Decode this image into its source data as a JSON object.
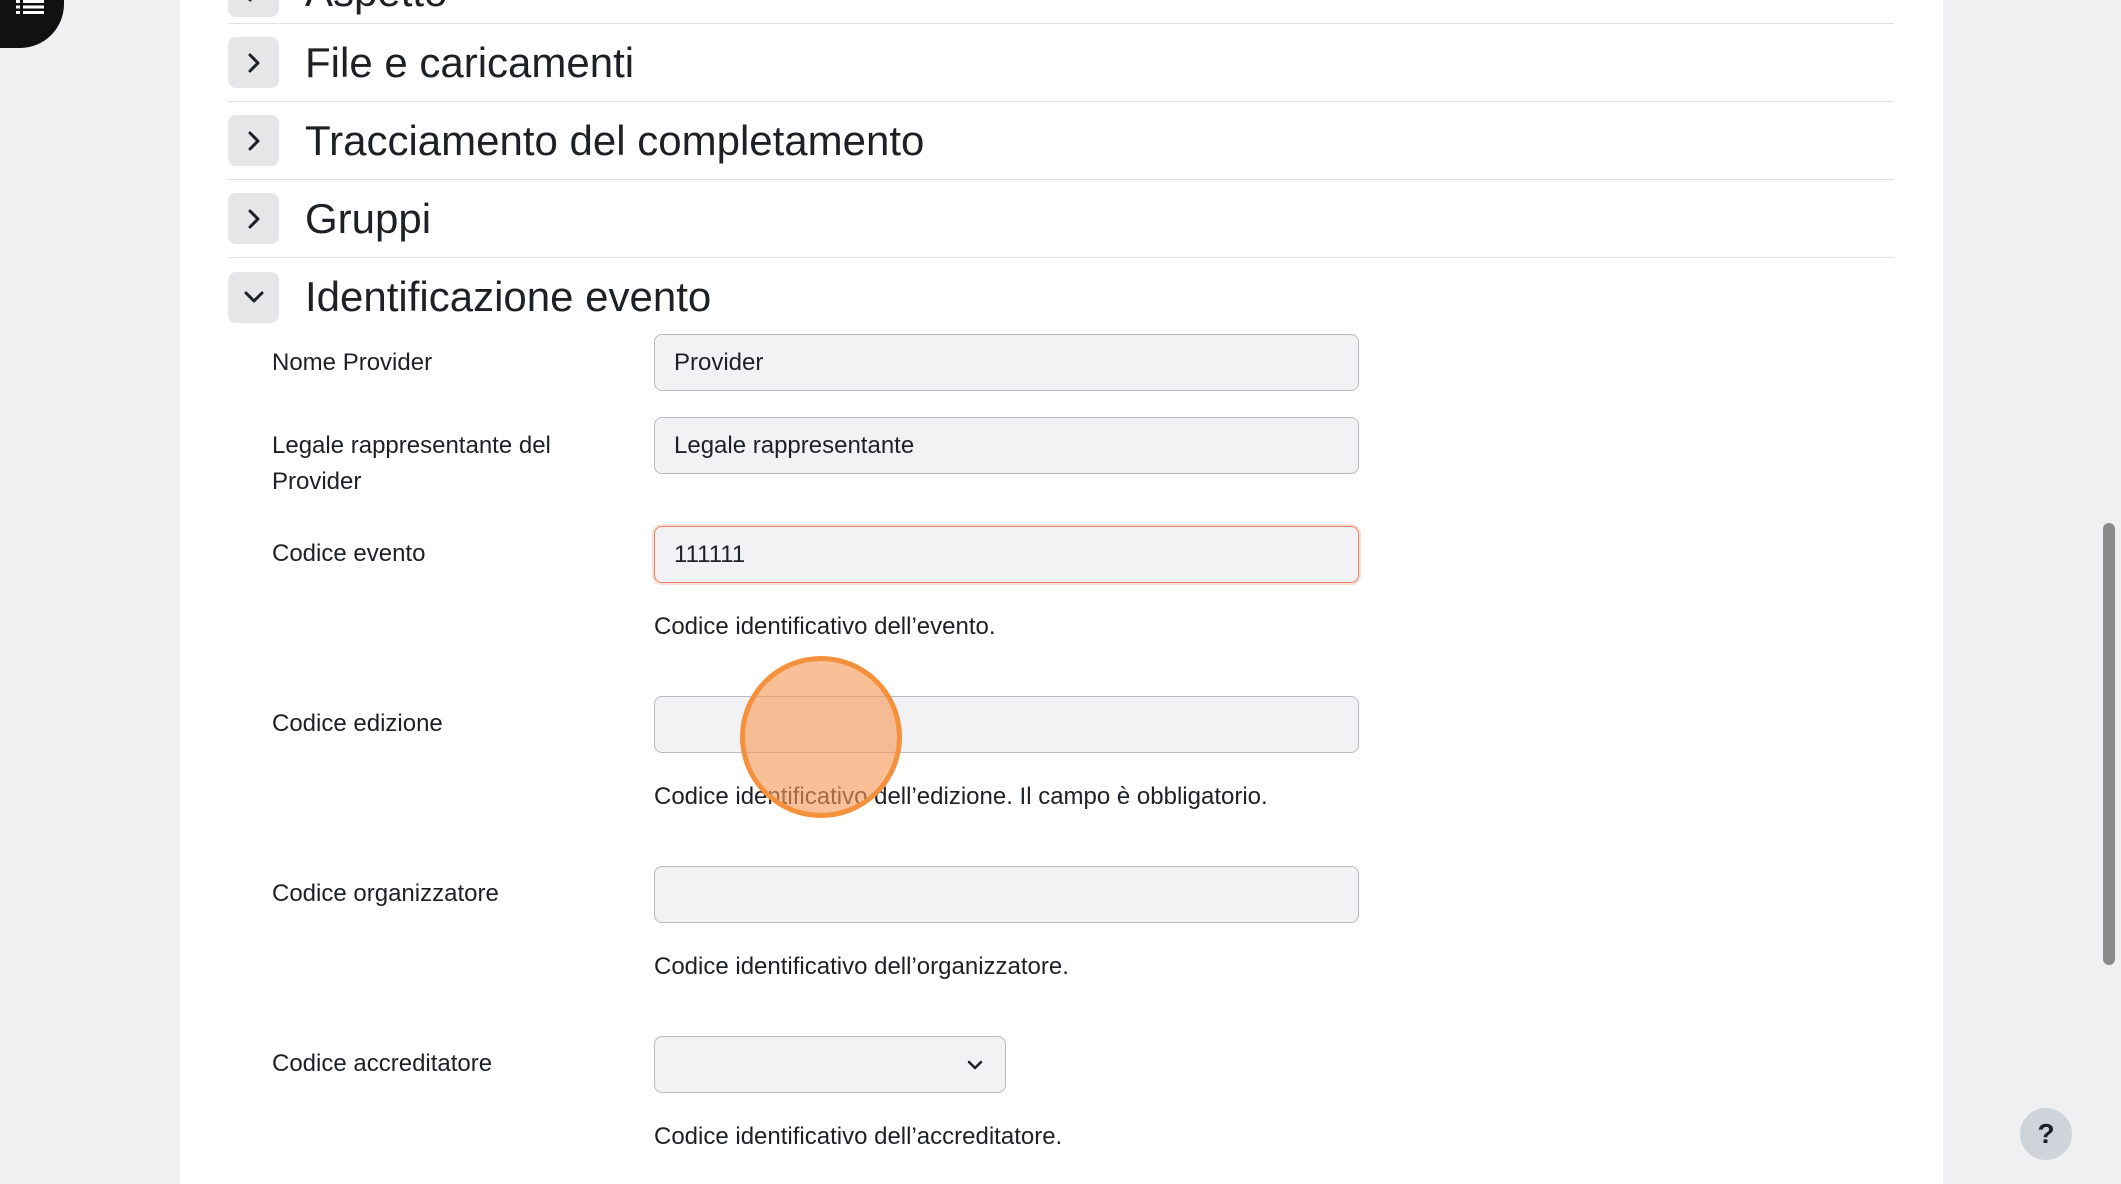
{
  "nav": {
    "drawer_icon": "list-icon"
  },
  "sections": {
    "partial_title": "Aspetto",
    "files": {
      "title": "File e caricamenti",
      "state": "collapsed"
    },
    "completion": {
      "title": "Tracciamento del completamento",
      "state": "collapsed"
    },
    "groups": {
      "title": "Gruppi",
      "state": "collapsed"
    },
    "event_id": {
      "title": "Identificazione evento",
      "state": "expanded"
    }
  },
  "form": {
    "provider_name": {
      "label": "Nome Provider",
      "value": "Provider"
    },
    "legal_rep": {
      "label": "Legale rappresentante del Provider",
      "value": "Legale rappresentante"
    },
    "event_code": {
      "label": "Codice evento",
      "value": "111111",
      "help": "Codice identificativo dell’evento."
    },
    "edition_code": {
      "label": "Codice edizione",
      "value": "",
      "help": "Codice identificativo dell’edizione. Il campo è obbligatorio."
    },
    "organizer_code": {
      "label": "Codice organizzatore",
      "value": "",
      "help": "Codice identificativo dell’organizzatore."
    },
    "accreditor_code": {
      "label": "Codice accreditatore",
      "value": "",
      "help": "Codice identificativo dell’accreditatore."
    }
  },
  "help_button": {
    "label": "?"
  },
  "colors": {
    "focus_border": "#e5866a",
    "click_marker": "#f5913c",
    "toggle_bg": "#e6e6e9"
  }
}
